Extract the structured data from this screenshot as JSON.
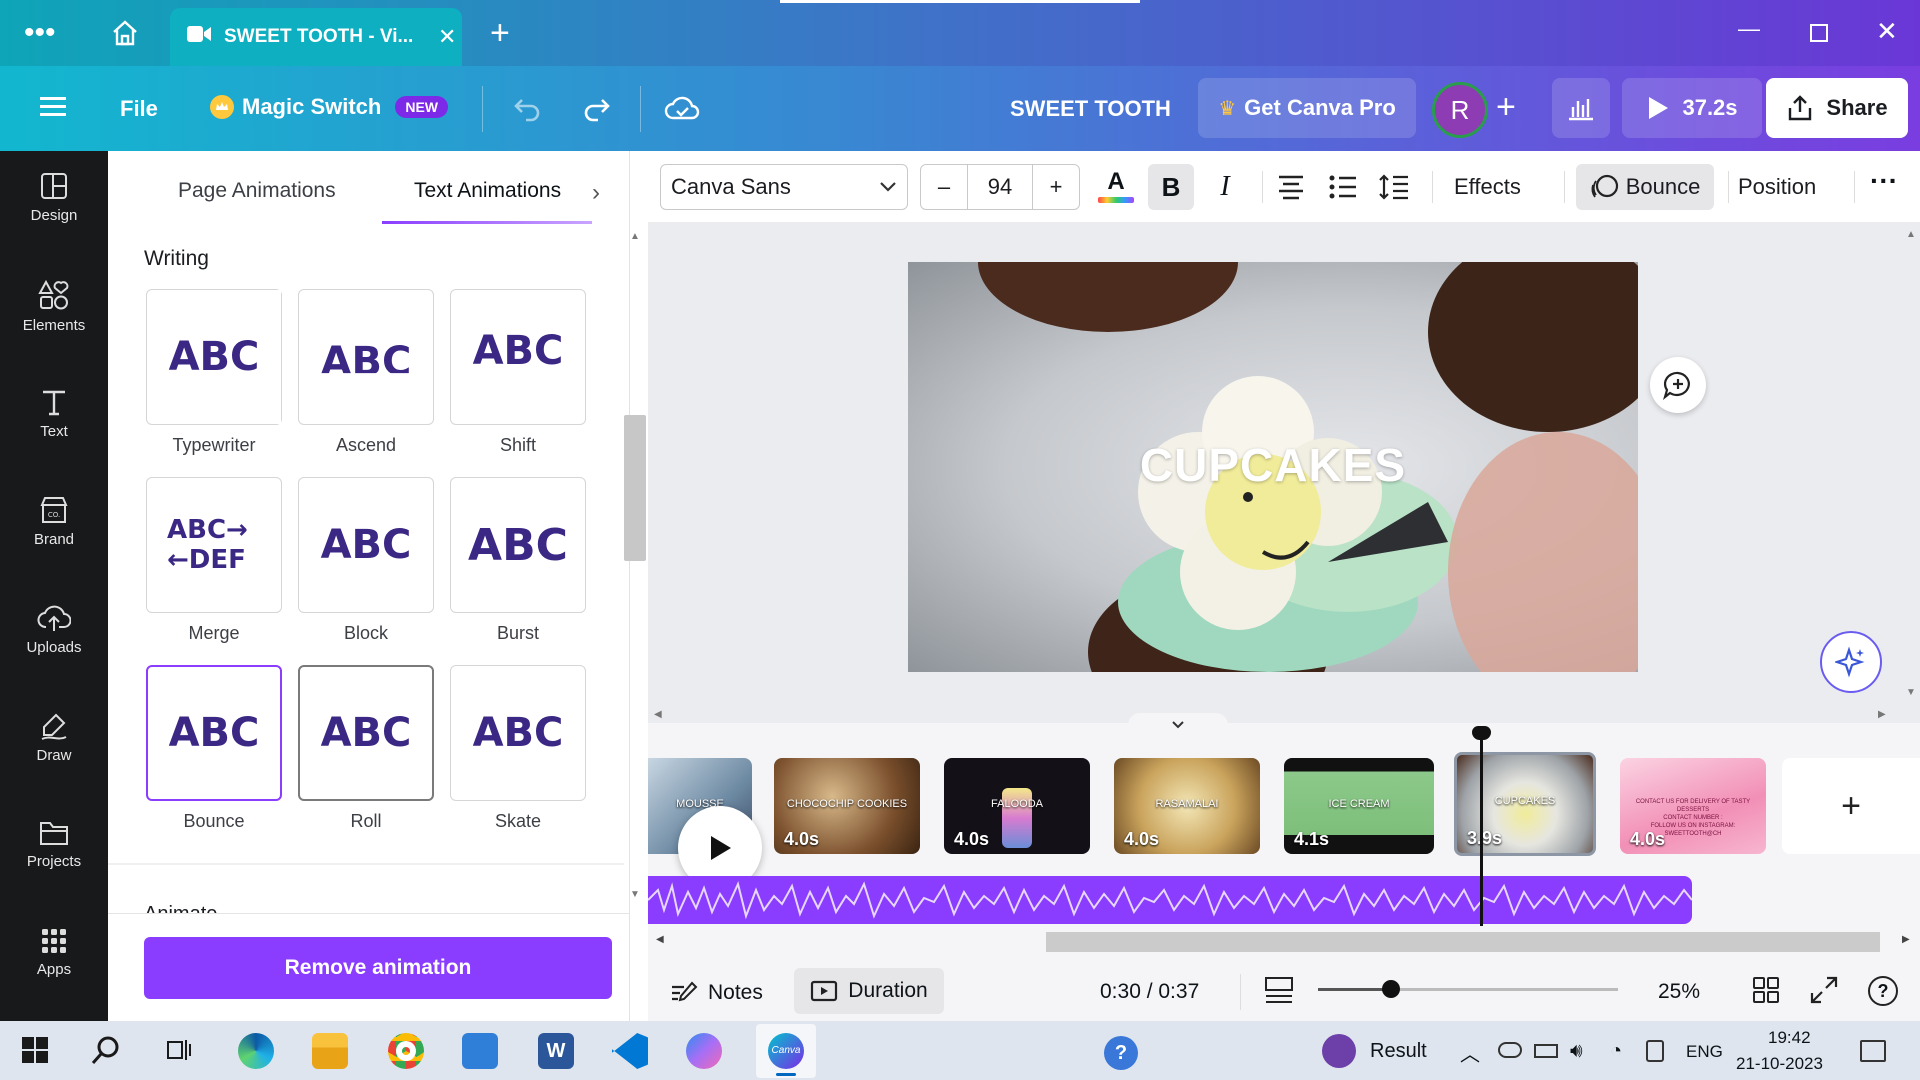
{
  "browser": {
    "tab_title": "SWEET TOOTH - Vi...",
    "menu_icon": "ellipsis-icon",
    "home_icon": "home-icon",
    "new_tab_icon": "plus-icon",
    "window_controls": [
      "minimize-icon",
      "restore-icon",
      "close-icon"
    ]
  },
  "header": {
    "menu_icon": "hamburger-icon",
    "file_label": "File",
    "magic_switch_label": "Magic Switch",
    "new_badge": "NEW",
    "doc_title": "SWEET TOOTH",
    "get_pro_label": "Get Canva Pro",
    "avatar_initial": "R",
    "timer_label": "37.2s",
    "share_label": "Share"
  },
  "rail": {
    "items": [
      {
        "label": "Design",
        "icon": "design-icon"
      },
      {
        "label": "Elements",
        "icon": "elements-icon"
      },
      {
        "label": "Text",
        "icon": "text-icon"
      },
      {
        "label": "Brand",
        "icon": "brand-icon"
      },
      {
        "label": "Uploads",
        "icon": "upload-icon"
      },
      {
        "label": "Draw",
        "icon": "draw-icon"
      },
      {
        "label": "Projects",
        "icon": "folder-icon"
      },
      {
        "label": "Apps",
        "icon": "apps-icon"
      }
    ]
  },
  "panel": {
    "tabs": [
      "Page Animations",
      "Text Animations"
    ],
    "active_tab": "Text Animations",
    "section_title": "Writing",
    "next_section_partial": "Animate",
    "animations": [
      {
        "label": "Typewriter",
        "glyph": "ABC"
      },
      {
        "label": "Ascend",
        "glyph": "ABC"
      },
      {
        "label": "Shift",
        "glyph": "ABC"
      },
      {
        "label": "Merge",
        "glyph": "ABC→ ←DEF"
      },
      {
        "label": "Block",
        "glyph": "ABC"
      },
      {
        "label": "Burst",
        "glyph": "ABC"
      },
      {
        "label": "Bounce",
        "glyph": "ABC"
      },
      {
        "label": "Roll",
        "glyph": "ABC"
      },
      {
        "label": "Skate",
        "glyph": "ABC"
      }
    ],
    "selected": "Bounce",
    "remove_label": "Remove animation"
  },
  "toolbar": {
    "font_name": "Canva Sans",
    "font_size": "94",
    "minus": "–",
    "plus": "+",
    "bold": "B",
    "italic": "I",
    "effects_label": "Effects",
    "bounce_label": "Bounce",
    "position_label": "Position"
  },
  "canvas": {
    "overlay_text": "CUPCAKES"
  },
  "timeline": {
    "clips": [
      {
        "name": "MOUSSE",
        "duration": "",
        "color": "#8aa6b9"
      },
      {
        "name": "CHOCOCHIP COOKIES",
        "duration": "4.0s",
        "color": "#6b4a2a"
      },
      {
        "name": "FALOODA",
        "duration": "4.0s",
        "color": "#1a1020"
      },
      {
        "name": "RASAMALAI",
        "duration": "4.0s",
        "color": "#c9a35c"
      },
      {
        "name": "ICE CREAM",
        "duration": "4.1s",
        "color": "#7dbf7a"
      },
      {
        "name": "CUPCAKES",
        "duration": "3.9s",
        "color": "#9ea3a8"
      },
      {
        "name": "",
        "duration": "4.0s",
        "color": "#f28fb6"
      }
    ],
    "last_clip_lines": [
      "CONTACT US FOR DELIVERY OF TASTY DESSERTS",
      "CONTACT NUMBER :",
      "FOLLOW US ON INSTAGRAM:",
      "SWEETTOOTH@CH"
    ],
    "notes_label": "Notes",
    "duration_label": "Duration",
    "time_readout": "0:30 / 0:37",
    "zoom_label": "25%",
    "zoom_level": 0.25
  },
  "taskbar": {
    "result_label": "Result",
    "lang": "ENG",
    "time": "19:42",
    "date": "21-10-2023"
  },
  "colors": {
    "accent": "#8b3dff",
    "brand_purple": "#3b2784",
    "rail_bg": "#18191b"
  }
}
